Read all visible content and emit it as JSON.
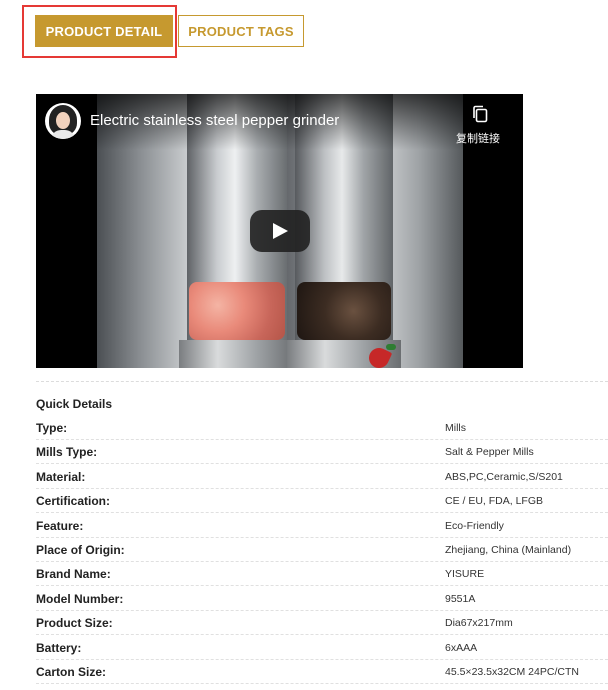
{
  "tabs": {
    "product_detail": "PRODUCT DETAIL",
    "product_tags": "PRODUCT TAGS"
  },
  "video": {
    "title": "Electric stainless steel pepper grinder",
    "copy_link_label": "复制链接",
    "play_icon": "play-icon"
  },
  "details": {
    "section_title": "Quick Details",
    "rows": [
      {
        "label": "Type:",
        "value": "Mills"
      },
      {
        "label": "Mills Type:",
        "value": "Salt & Pepper Mills"
      },
      {
        "label": "Material:",
        "value": "ABS,PC,Ceramic,S/S201"
      },
      {
        "label": "Certification:",
        "value": "CE / EU, FDA, LFGB"
      },
      {
        "label": "Feature:",
        "value": "Eco-Friendly"
      },
      {
        "label": "Place of Origin:",
        "value": "Zhejiang, China (Mainland)"
      },
      {
        "label": "Brand Name:",
        "value": "YISURE"
      },
      {
        "label": "Model Number:",
        "value": "9551A"
      },
      {
        "label": "Product Size:",
        "value": "Dia67x217mm"
      },
      {
        "label": "Battery:",
        "value": "6xAAA"
      },
      {
        "label": "Carton Size:",
        "value": "45.5×23.5x32CM 24PC/CTN"
      }
    ]
  },
  "colors": {
    "accent": "#c6992f",
    "highlight_border": "#e53935"
  }
}
